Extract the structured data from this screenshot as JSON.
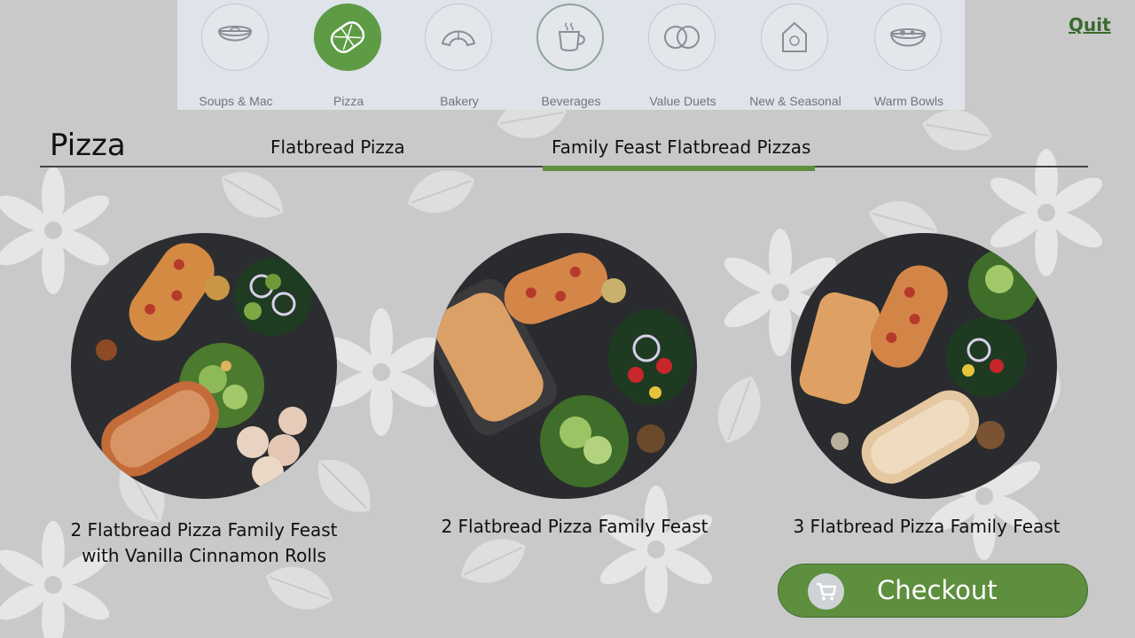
{
  "header": {
    "categories": [
      {
        "label": "Soups & Mac",
        "icon": "soup-bowl-icon"
      },
      {
        "label": "Pizza",
        "icon": "pizza-icon"
      },
      {
        "label": "Bakery",
        "icon": "croissant-icon"
      },
      {
        "label": "Beverages",
        "icon": "coffee-cup-icon"
      },
      {
        "label": "Value Duets",
        "icon": "duet-rings-icon"
      },
      {
        "label": "New & Seasonal",
        "icon": "seasonal-house-icon"
      },
      {
        "label": "Warm Bowls",
        "icon": "warm-bowl-icon"
      }
    ],
    "active_category": "Pizza",
    "quit_label": "Quit"
  },
  "section": {
    "title": "Pizza",
    "tabs": [
      {
        "label": "Flatbread Pizza"
      },
      {
        "label": "Family Feast Flatbread Pizzas"
      }
    ],
    "active_tab": "Family Feast Flatbread Pizzas"
  },
  "products": [
    {
      "name_line1": "2 Flatbread Pizza Family Feast",
      "name_line2": "with Vanilla Cinnamon Rolls"
    },
    {
      "name_line1": "2 Flatbread Pizza Family Feast",
      "name_line2": ""
    },
    {
      "name_line1": "3 Flatbread Pizza Family Feast",
      "name_line2": ""
    }
  ],
  "checkout": {
    "label": "Checkout",
    "icon": "cart-icon"
  },
  "colors": {
    "accent": "#5e8f3e",
    "active_icon_bg": "#5e9b45",
    "quit_text": "#3a6b2e"
  }
}
